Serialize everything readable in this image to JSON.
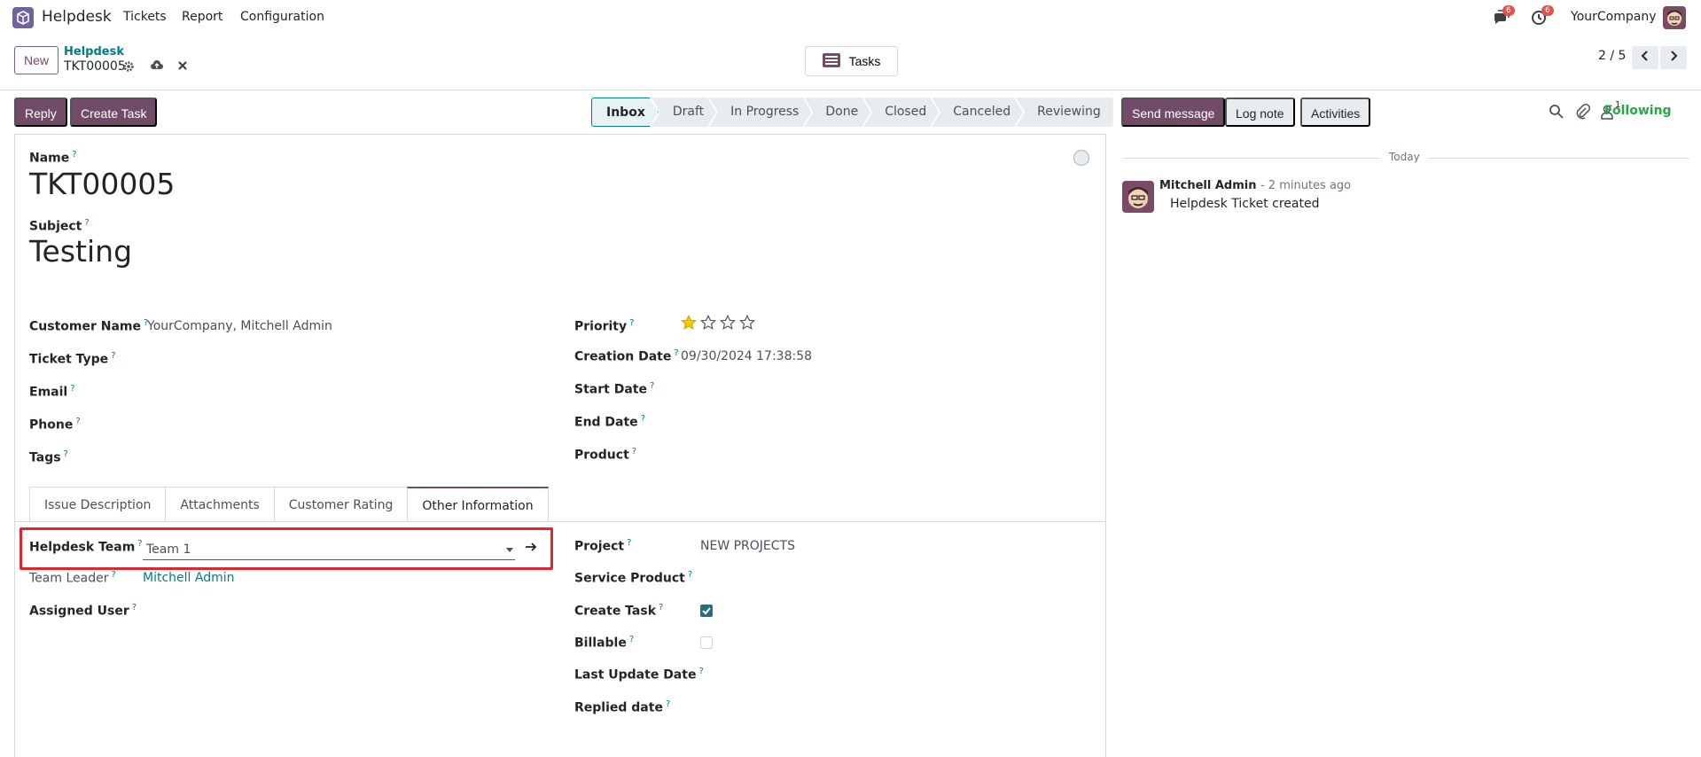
{
  "navbar": {
    "app_name": "Helpdesk",
    "menu": [
      "Tickets",
      "Report",
      "Configuration"
    ],
    "messages_badge": "6",
    "activities_badge": "6",
    "company": "YourCompany"
  },
  "control_panel": {
    "new_label": "New",
    "breadcrumb_parent": "Helpdesk",
    "breadcrumb_current": "TKT00005",
    "tasks_label": "Tasks",
    "pager": "2 / 5"
  },
  "form_header": {
    "reply_label": "Reply",
    "create_task_label": "Create Task",
    "stages": [
      "Inbox",
      "Draft",
      "In Progress",
      "Done",
      "Closed",
      "Canceled",
      "Reviewing"
    ],
    "active_stage": "Inbox"
  },
  "form": {
    "name_label": "Name",
    "name_value": "TKT00005",
    "subject_label": "Subject",
    "subject_value": "Testing",
    "left_fields": [
      {
        "label": "Customer Name",
        "value": "YourCompany, Mitchell Admin"
      },
      {
        "label": "Ticket Type",
        "value": ""
      },
      {
        "label": "Email",
        "value": ""
      },
      {
        "label": "Phone",
        "value": ""
      },
      {
        "label": "Tags",
        "value": ""
      }
    ],
    "right_fields": [
      {
        "label": "Priority",
        "value": ""
      },
      {
        "label": "Creation Date",
        "value": "09/30/2024 17:38:58"
      },
      {
        "label": "Start Date",
        "value": ""
      },
      {
        "label": "End Date",
        "value": ""
      },
      {
        "label": "Product",
        "value": ""
      }
    ],
    "priority_stars": 1,
    "priority_max": 4,
    "tabs": [
      "Issue Description",
      "Attachments",
      "Customer Rating",
      "Other Information"
    ],
    "active_tab": "Other Information",
    "other_info": {
      "helpdesk_team_label": "Helpdesk Team",
      "helpdesk_team_value": "Team 1",
      "team_leader_label": "Team Leader",
      "team_leader_value": "Mitchell Admin",
      "assigned_user_label": "Assigned User",
      "project_label": "Project",
      "project_value": "NEW PROJECTS",
      "service_product_label": "Service Product",
      "create_task_label": "Create Task",
      "create_task_checked": true,
      "billable_label": "Billable",
      "billable_checked": false,
      "last_update_label": "Last Update Date",
      "replied_date_label": "Replied date"
    }
  },
  "chatter": {
    "send_message_label": "Send message",
    "log_note_label": "Log note",
    "activities_label": "Activities",
    "followers_count": "1",
    "following_label": "Following",
    "today_label": "Today",
    "message": {
      "author": "Mitchell Admin",
      "time": "- 2 minutes ago",
      "body": "Helpdesk Ticket created"
    }
  },
  "colors": {
    "brand": "#714b67",
    "link": "#017e84",
    "highlight": "#e0262b",
    "following": "#28a745"
  },
  "tooltip_mark": "?"
}
